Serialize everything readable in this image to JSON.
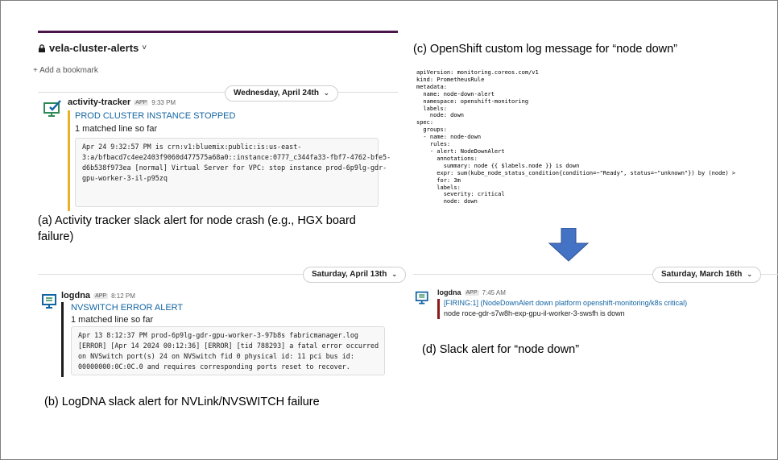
{
  "panel_a": {
    "channel_name": "vela-cluster-alerts",
    "channel_chevron": "˅",
    "bookmark": "+ Add a bookmark",
    "date": "Wednesday, April 24th",
    "sender": "activity-tracker",
    "app_badge": "APP",
    "time": "9:33 PM",
    "alert_title": "PROD CLUSTER INSTANCE STOPPED",
    "matched": "1 matched line so far",
    "log_lines": [
      "Apr 24 9:32:57 PM is crn:v1:bluemix:public:is:us-east-",
      "3:a/bfbacd7c4ee2403f9060d477575a68a0::instance:0777_c344fa33-fbf7-4762-bfe5-",
      "d6b538f973ea [normal] Virtual Server for VPC: stop instance prod-6p9lg-gdr-",
      "gpu-worker-3-il-p95zq"
    ],
    "caption_line1": "(a) Activity tracker slack alert for node crash (e.g., HGX board",
    "caption_line2": "failure)",
    "accent_color": "#e8b02b"
  },
  "panel_b": {
    "date": "Saturday, April 13th",
    "sender": "logdna",
    "app_badge": "APP",
    "time": "8:12 PM",
    "alert_title": "NVSWITCH ERROR ALERT",
    "matched": "1 matched line so far",
    "log_lines": [
      "Apr 13 8:12:37 PM prod-6p9lg-gdr-gpu-worker-3-97b8s fabricmanager.log",
      "[ERROR] [Apr 14 2024 00:12:36] [ERROR] [tid 788293] a fatal error occurred",
      "on NVSwitch port(s) 24 on NVSwitch fid 0 physical id: 11 pci bus id:",
      "00000000:0C:0C.0 and requires corresponding ports reset to recover."
    ],
    "caption": "(b) LogDNA slack alert for NVLink/NVSWITCH failure",
    "accent_color": "#1d1c1d"
  },
  "panel_c": {
    "caption": "(c) OpenShift custom log message for “node down”",
    "yaml_lines": [
      "apiVersion: monitoring.coreos.com/v1",
      "kind: PrometheusRule",
      "metadata:",
      "  name: node-down-alert",
      "  namespace: openshift-monitoring",
      "  labels:",
      "    node: down",
      "spec:",
      "  groups:",
      "  - name: node-down",
      "    rules:",
      "    - alert: NodeDownAlert",
      "      annotations:",
      "        summary: node {{ $labels.node }} is down",
      "      expr: sum(kube_node_status_condition{condition=~\"Ready\", status=~\"unknown\"}) by (node) >",
      "      for: 3m",
      "      labels:",
      "        severity: critical",
      "        node: down"
    ],
    "arrow_color": "#4472c4"
  },
  "panel_d": {
    "date": "Saturday, March 16th",
    "sender": "logdna",
    "app_badge": "APP",
    "time": "7:45 AM",
    "firing": "[FIRING:1]  (NodeDownAlert down platform openshift-monitoring/k8s critical)",
    "node_line": "node roce-gdr-s7w8h-exp-gpu-il-worker-3-swsfh is down",
    "caption": "(d) Slack alert for “node down”",
    "accent_color": "#8b1a1a"
  }
}
